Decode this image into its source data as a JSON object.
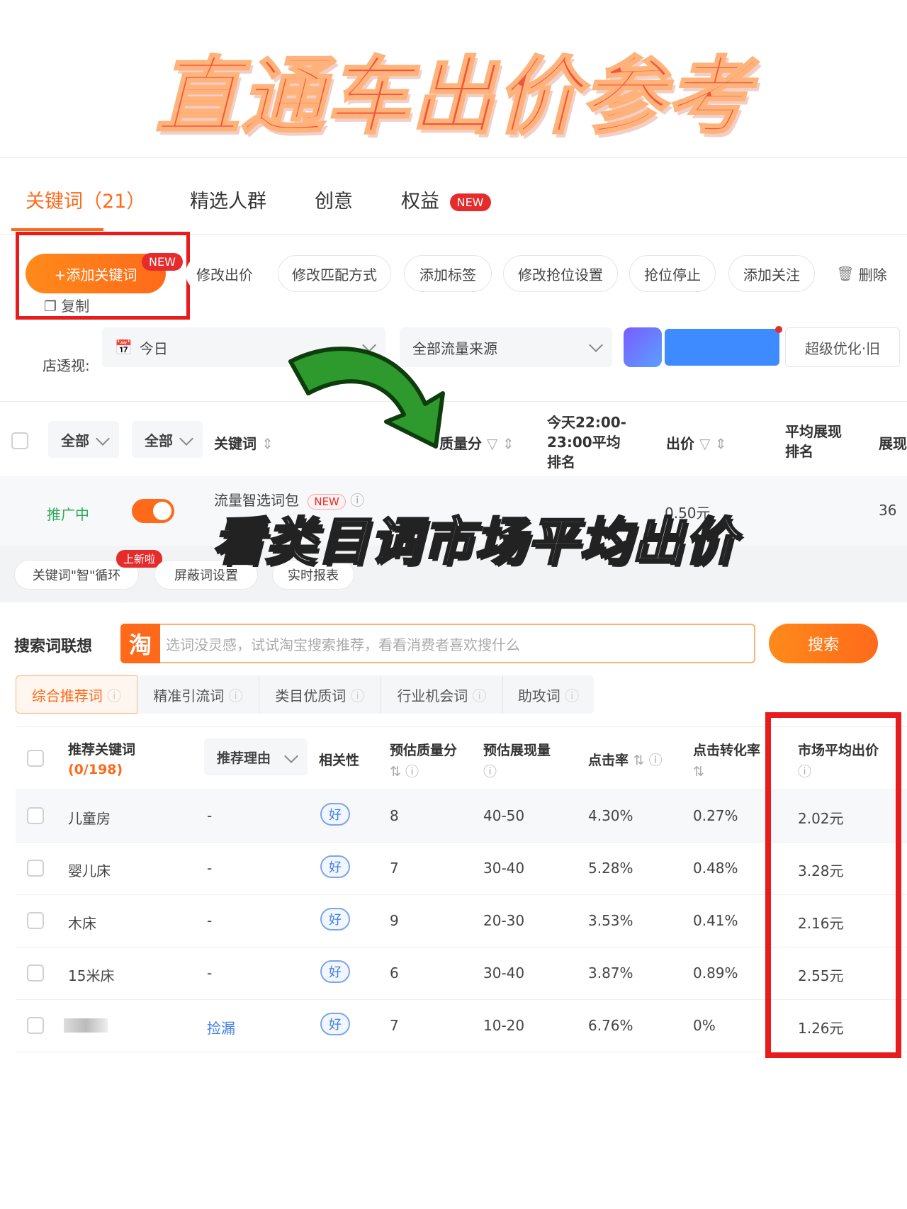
{
  "banner_title": "直通车出价参考",
  "tabs": [
    {
      "label": "关键词（21）",
      "active": true
    },
    {
      "label": "精选人群"
    },
    {
      "label": "创意"
    },
    {
      "label": "权益",
      "badge": "NEW"
    }
  ],
  "toolbar": {
    "add_keyword": "+添加关键词",
    "add_keyword_badge": "NEW",
    "copy": "复制",
    "buttons": [
      "修改出价",
      "修改匹配方式",
      "添加标签",
      "修改抢位设置",
      "抢位停止",
      "添加关注"
    ],
    "delete": "删除"
  },
  "store_view": {
    "label": "店透视:",
    "date": "今日",
    "traffic_source": "全部流量来源",
    "super_optimize": "超级优化·旧"
  },
  "keyword_table": {
    "filter1": "全部",
    "filter2": "全部",
    "col_keyword": "关键词",
    "col_quality": "质量分",
    "col_today_rank": "今天22:00-23:00平均排名",
    "col_bid": "出价",
    "col_avg_rank": "平均展现排名",
    "col_impr": "展现",
    "row": {
      "status": "推广中",
      "name": "流量智选词包",
      "badge": "NEW",
      "bid_partial": "0.50元",
      "impr_partial": "36"
    }
  },
  "overlay_caption": "看类目词市场平均出价",
  "tool_pills": [
    {
      "label": "关键词\"智\"循环",
      "badge": "上新啦"
    },
    {
      "label": "屏蔽词设置"
    },
    {
      "label": "实时报表"
    }
  ],
  "search_suggest": {
    "label": "搜索词联想",
    "icon_text": "淘",
    "placeholder": "选词没灵感，试试淘宝搜索推荐，看看消费者喜欢搜什么",
    "button": "搜索"
  },
  "sub_tabs": [
    "综合推荐词",
    "精准引流词",
    "类目优质词",
    "行业机会词",
    "助攻词"
  ],
  "rec_table": {
    "headers": {
      "keyword": "推荐关键词",
      "count": "(0/198)",
      "reason": "推荐理由",
      "relevance": "相关性",
      "quality": "预估质量分",
      "impr": "预估展现量",
      "ctr": "点击率",
      "cvr": "点击转化率",
      "avg_bid": "市场平均出价"
    },
    "rows": [
      {
        "keyword": "儿童房",
        "reason": "-",
        "relevance": "好",
        "quality": "8",
        "impr": "40-50",
        "ctr": "4.30%",
        "cvr": "0.27%",
        "avg_bid": "2.02元"
      },
      {
        "keyword": "婴儿床",
        "reason": "-",
        "relevance": "好",
        "quality": "7",
        "impr": "30-40",
        "ctr": "5.28%",
        "cvr": "0.48%",
        "avg_bid": "3.28元"
      },
      {
        "keyword": "木床",
        "reason": "-",
        "relevance": "好",
        "quality": "9",
        "impr": "20-30",
        "ctr": "3.53%",
        "cvr": "0.41%",
        "avg_bid": "2.16元"
      },
      {
        "keyword": "15米床",
        "reason": "-",
        "relevance": "好",
        "quality": "6",
        "impr": "30-40",
        "ctr": "3.87%",
        "cvr": "0.89%",
        "avg_bid": "2.55元"
      },
      {
        "keyword": "",
        "reason": "捡漏",
        "relevance": "好",
        "quality": "7",
        "impr": "10-20",
        "ctr": "6.76%",
        "cvr": "0%",
        "avg_bid": "1.26元"
      }
    ]
  },
  "colors": {
    "accent": "#ff6a1a",
    "highlight": "#e81c1c",
    "arrow": "#2e9a2e"
  }
}
